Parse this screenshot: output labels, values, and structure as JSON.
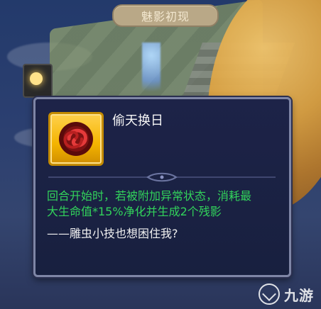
{
  "header": {
    "title": "魅影初现"
  },
  "tooltip": {
    "skill_name": "偷天换日",
    "description_line1": "回合开始时，若被附加异常状态，消耗最",
    "description_line2": "大生命值*15%净化并生成2个残影",
    "quote": "——雕虫小技也想困住我?",
    "icon": "swirl-emblem-icon",
    "colors": {
      "description": "#32d35b",
      "quote": "#f0f0f0",
      "panel_bg": "#1d2348",
      "icon_bg": "#f4b400"
    }
  },
  "watermark": {
    "text": "九游"
  }
}
